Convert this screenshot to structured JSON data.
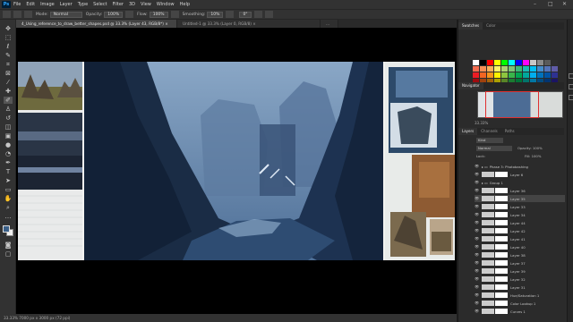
{
  "app": {
    "logo": "Ps"
  },
  "menu": [
    "File",
    "Edit",
    "Image",
    "Layer",
    "Type",
    "Select",
    "Filter",
    "3D",
    "View",
    "Window",
    "Help"
  ],
  "window_controls": {
    "minimize": "–",
    "maximize": "□",
    "close": "✕"
  },
  "options_bar": {
    "mode_label": "Mode:",
    "mode_value": "Normal",
    "opacity_label": "Opacity:",
    "opacity_value": "100%",
    "flow_label": "Flow:",
    "flow_value": "100%",
    "smoothing_label": "Smoothing:",
    "smoothing_value": "10%",
    "angle_value": "0°"
  },
  "tabs": [
    {
      "label": "4_Using_reference_to_draw_better_shapes.psd @ 33.3% (Layer 43, RGB/8*) ×"
    },
    {
      "label": "Untitled-1 @ 33.3% (Layer 0, RGB/8) ×"
    },
    {
      "label": "..."
    }
  ],
  "status": "33.33%     7000 px x 3000 px (72 ppi)",
  "right_panel": {
    "swatches_tabs": [
      "Swatches",
      "Color"
    ],
    "navigator_tabs": [
      "Navigator"
    ],
    "nav_zoom": "33.33%",
    "layers_tabs": [
      "Layers",
      "Channels",
      "Paths"
    ],
    "kind_label": "Kind",
    "blend_mode": "Normal",
    "opacity_label": "Opacity:",
    "opacity_value": "100%",
    "lock_label": "Lock:",
    "fill_label": "Fill:",
    "fill_value": "100%",
    "swatch_colors": [
      "#ffffff",
      "#000000",
      "#ff0000",
      "#ffff00",
      "#00ff00",
      "#00ffff",
      "#0000ff",
      "#ff00ff",
      "#c8c8c8",
      "#8a8a8a",
      "#5a5a5a",
      "#2e2e2e",
      "#f26c4f",
      "#f68e55",
      "#fbaf5c",
      "#fff467",
      "#acd372",
      "#7cc576",
      "#3bb878",
      "#1abbb4",
      "#00bff3",
      "#438ccb",
      "#5574b9",
      "#605ca8",
      "#ed1c24",
      "#f26522",
      "#f7941d",
      "#fff200",
      "#8dc63f",
      "#39b54a",
      "#00a651",
      "#00a99d",
      "#00aeef",
      "#0072bc",
      "#0054a6",
      "#2e3192",
      "#9e0b0f",
      "#a0410d",
      "#a36209",
      "#aba000",
      "#598527",
      "#1a7b30",
      "#007236",
      "#00746b",
      "#0076a3",
      "#004b80",
      "#003471",
      "#1b1464"
    ],
    "layers": [
      {
        "name": "Phase 3: Photobashing",
        "group": true,
        "selected": false
      },
      {
        "name": "Layer 6",
        "group": false,
        "selected": false
      },
      {
        "name": "Group 1",
        "group": true,
        "selected": false
      },
      {
        "name": "Layer 36",
        "group": false,
        "selected": false
      },
      {
        "name": "Layer 35",
        "group": false,
        "selected": true
      },
      {
        "name": "Layer 33",
        "group": false,
        "selected": false
      },
      {
        "name": "Layer 34",
        "group": false,
        "selected": false
      },
      {
        "name": "Layer 44",
        "group": false,
        "selected": false
      },
      {
        "name": "Layer 42",
        "group": false,
        "selected": false
      },
      {
        "name": "Layer 41",
        "group": false,
        "selected": false
      },
      {
        "name": "Layer 40",
        "group": false,
        "selected": false
      },
      {
        "name": "Layer 38",
        "group": false,
        "selected": false
      },
      {
        "name": "Layer 37",
        "group": false,
        "selected": false
      },
      {
        "name": "Layer 39",
        "group": false,
        "selected": false
      },
      {
        "name": "Layer 32",
        "group": false,
        "selected": false
      },
      {
        "name": "Layer 31",
        "group": false,
        "selected": false
      },
      {
        "name": "Hue/Saturation 1",
        "group": false,
        "selected": false
      },
      {
        "name": "Color Lookup 1",
        "group": false,
        "selected": false
      },
      {
        "name": "Curves 1",
        "group": false,
        "selected": false
      }
    ]
  }
}
